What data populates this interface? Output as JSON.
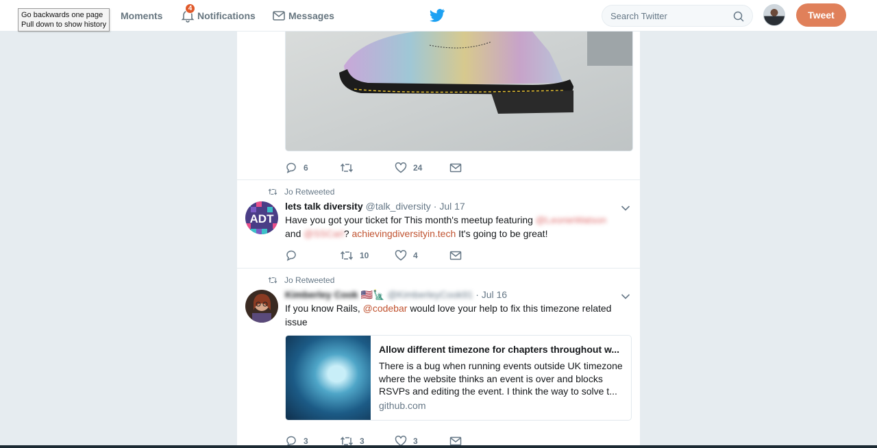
{
  "tooltip": {
    "line1": "Go backwards one page",
    "line2": "Pull down to show history"
  },
  "nav": {
    "moments": "Moments",
    "notifications": "Notifications",
    "notification_count": "4",
    "messages": "Messages"
  },
  "search": {
    "placeholder": "Search Twitter"
  },
  "tweet_button": "Tweet",
  "top_tweet": {
    "replies": "6",
    "retweets": "",
    "likes": "24"
  },
  "tweet1": {
    "retweet_label": "Jo Retweeted",
    "avatar_text": "ADT",
    "name": "lets talk diversity",
    "handle": "@talk_diversity",
    "date": "· Jul 17",
    "text_a": "Have you got your ticket for This month's meetup featuring",
    "mention1": "@LeonieWatson",
    "text_b": "and",
    "mention2": "@SSCarl",
    "text_c": "?",
    "link": "achievingdiversityin.tech",
    "text_d": "It's going to be great!",
    "replies": "",
    "retweets": "10",
    "likes": "4"
  },
  "tweet2": {
    "retweet_label": "Jo Retweeted",
    "name": "Kimberley Cook",
    "flags": "🇺🇸🗽",
    "handle": "@KimberleyCook91",
    "date": "· Jul 16",
    "text_a": "If you know Rails,",
    "mention": "@codebar",
    "text_b": "would love your help to fix this timezone related issue",
    "card": {
      "title": "Allow different timezone for chapters throughout w...",
      "description": "There is a bug when running events outside UK timezone where the website thinks an event is over and blocks RSVPs and editing the event. I think the way to solve t...",
      "domain": "github.com"
    },
    "replies": "3",
    "retweets": "3",
    "likes": "3"
  }
}
